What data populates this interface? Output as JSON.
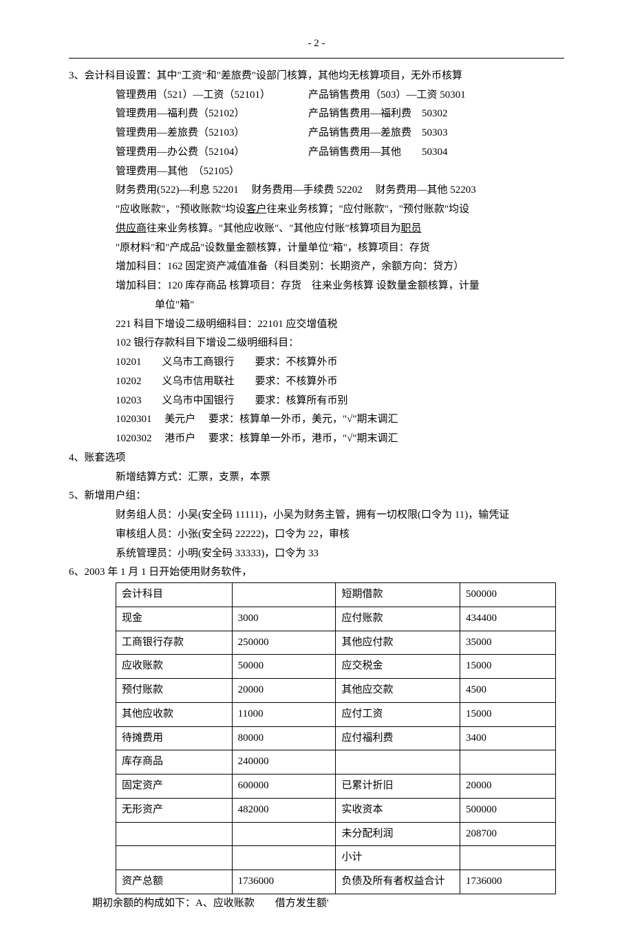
{
  "pageNumber": "- 2 -",
  "s3": {
    "heading": "3、会计科目设置：其中\"工资\"和\"差旅费\"设部门核算，其他均无核算项目，无外币核算",
    "rows": [
      {
        "l": "管理费用（521）—工资（52101）",
        "r": "产品销售费用（503）—工资 50301"
      },
      {
        "l": "管理费用—福利费（52102）",
        "r": "产品销售费用—福利费　50302"
      },
      {
        "l": "管理费用—差旅费（52103）",
        "r": "产品销售费用—差旅费　50303"
      },
      {
        "l": "管理费用—办公费（52104）",
        "r": "产品销售费用—其他　　50304"
      },
      {
        "l": "管理费用—其他　（52105）",
        "r": ""
      }
    ],
    "line6": "财务费用(522)—利息 52201　 财务费用—手续费 52202　 财务费用—其他 52203",
    "line7a": "\"应收账款\"，\"预收账款\"均设",
    "line7u1": "客户",
    "line7b": "往来业务核算；\"应付账款\"，\"预付账款\"均设",
    "line8u": "供应商",
    "line8a": "往来业务核算。\"其他应收账\"、\"其他应付账\"核算项目为",
    "line8u2": "职员",
    "line9": "\"原材料\"和\"产成品\"设数量金额核算，计量单位\"箱\"，核算项目：存货",
    "line10": "增加科目：162 固定资产减值准备（科目类别：长期资产，余额方向：贷方）",
    "line11": "增加科目：120 库存商品 核算项目：存货　往来业务核算 设数量金额核算，计量",
    "line11b": "单位\"箱\"",
    "line12": "221 科目下增设二级明细科目：22101 应交增值税",
    "line13": "102 银行存款科目下增设二级明细科目：",
    "sub": [
      "10201　　义乌市工商银行　　要求：不核算外币",
      "10202　　义乌市信用联社　　要求：不核算外币",
      "10203　　义乌市中国银行　　要求：核算所有币别",
      "1020301　 美元户　 要求：核算单一外币，美元，\"√\"期末调汇",
      "1020302　 港币户　 要求：核算单一外币，港币，\"√\"期末调汇"
    ]
  },
  "s4": {
    "heading": "4、账套选项",
    "line": "新增结算方式：汇票，支票，本票"
  },
  "s5": {
    "heading": "5、新增用户组：",
    "l1": "财务组人员：小吴(安全码 11111)，小吴为财务主管，拥有一切权限(口令为 11)，输凭证",
    "l2": "审核组人员：小张(安全码 22222)，口令为 22，审核",
    "l3": "系统管理员：小明(安全码 33333)，口令为 33"
  },
  "s6": {
    "heading": "6、2003 年 1 月 1 日开始使用财务软件，",
    "table": [
      [
        "会计科目",
        "",
        "短期借款",
        "500000"
      ],
      [
        "现金",
        "3000",
        "应付账款",
        "434400"
      ],
      [
        "工商银行存款",
        "250000",
        "其他应付款",
        "35000"
      ],
      [
        "应收账款",
        "50000",
        "应交税金",
        "15000"
      ],
      [
        "预付账款",
        "20000",
        "其他应交款",
        "4500"
      ],
      [
        "其他应收款",
        "11000",
        "应付工资",
        "15000"
      ],
      [
        "待摊费用",
        "80000",
        "应付福利费",
        "3400"
      ],
      [
        "库存商品",
        "240000",
        "",
        ""
      ],
      [
        "固定资产",
        "600000",
        "已累计折旧",
        "20000"
      ],
      [
        "无形资产",
        "482000",
        "实收资本",
        "500000"
      ],
      [
        "",
        "",
        "未分配利润",
        "208700"
      ],
      [
        "",
        "",
        "小计",
        ""
      ],
      [
        "资产总额",
        "1736000",
        "负债及所有者权益合计",
        "1736000"
      ]
    ],
    "footer": "期初余额的构成如下：A、应收账款　　借方发生额'"
  }
}
